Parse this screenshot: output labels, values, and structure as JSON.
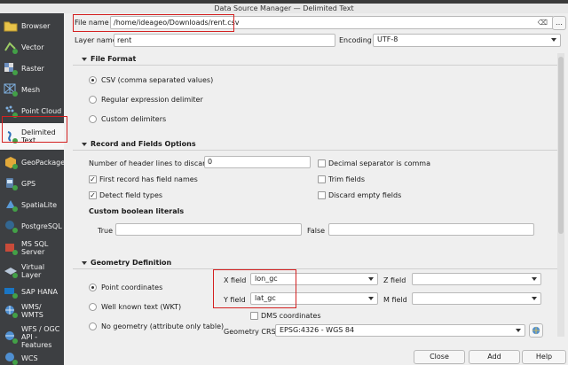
{
  "window": {
    "title": "Data Source Manager — Delimited Text"
  },
  "sidebar": {
    "items": [
      {
        "label": "Browser",
        "icon": "folder-icon"
      },
      {
        "label": "Vector",
        "icon": "vector-layer-icon"
      },
      {
        "label": "Raster",
        "icon": "raster-layer-icon"
      },
      {
        "label": "Mesh",
        "icon": "mesh-layer-icon"
      },
      {
        "label": "Point Cloud",
        "icon": "point-cloud-icon"
      },
      {
        "label": "Delimited Text",
        "icon": "delimited-text-icon"
      },
      {
        "label": "GeoPackage",
        "icon": "geopackage-icon"
      },
      {
        "label": "GPS",
        "icon": "gps-icon"
      },
      {
        "label": "SpatiaLite",
        "icon": "spatialite-icon"
      },
      {
        "label": "PostgreSQL",
        "icon": "postgresql-icon"
      },
      {
        "label": "MS SQL Server",
        "icon": "mssql-icon"
      },
      {
        "label": "Virtual Layer",
        "icon": "virtual-layer-icon"
      },
      {
        "label": "SAP HANA",
        "icon": "sap-hana-icon"
      },
      {
        "label": "WMS/ WMTS",
        "icon": "wms-icon"
      },
      {
        "label": "WFS / OGC API - Features",
        "icon": "wfs-icon"
      },
      {
        "label": "WCS",
        "icon": "wcs-icon"
      }
    ]
  },
  "file": {
    "label": "File name",
    "value": "/home/ideageo/Downloads/rent.csv"
  },
  "layer": {
    "label": "Layer name",
    "value": "rent"
  },
  "encoding": {
    "label": "Encoding",
    "value": "UTF-8"
  },
  "file_format": {
    "title": "File Format",
    "options": [
      "CSV (comma separated values)",
      "Regular expression delimiter",
      "Custom delimiters"
    ],
    "selected": 0
  },
  "record_fields": {
    "title": "Record and Fields Options",
    "header_lines_label": "Number of header lines to discard",
    "header_lines_value": "0",
    "first_record_label": "First record has field names",
    "detect_types_label": "Detect field types",
    "decimal_sep_label": "Decimal separator is comma",
    "trim_fields_label": "Trim fields",
    "discard_empty_label": "Discard empty fields",
    "boolean_title": "Custom boolean literals",
    "true_label": "True",
    "false_label": "False"
  },
  "geometry": {
    "title": "Geometry Definition",
    "point_label": "Point coordinates",
    "wkt_label": "Well known text (WKT)",
    "none_label": "No geometry (attribute only table)",
    "x_label": "X field",
    "x_value": "lon_gc",
    "y_label": "Y field",
    "y_value": "lat_gc",
    "z_label": "Z field",
    "m_label": "M field",
    "dms_label": "DMS coordinates",
    "crs_label": "Geometry CRS",
    "crs_value": "EPSG:4326 - WGS 84"
  },
  "buttons": {
    "close": "Close",
    "add": "Add",
    "help": "Help"
  },
  "colors": {
    "sidebar": "#3d3f42",
    "highlight": "#d42020"
  }
}
